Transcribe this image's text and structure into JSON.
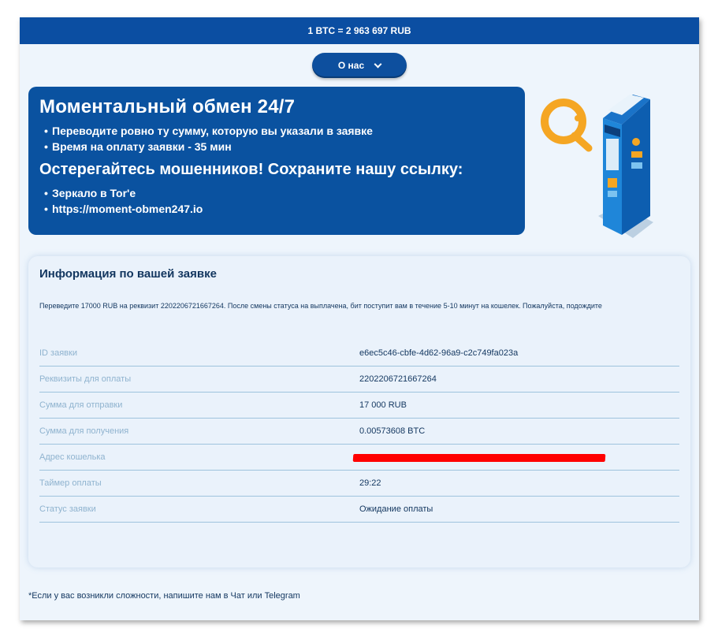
{
  "header": {
    "rate": "1 BTC = 2 963 697 RUB"
  },
  "nav": {
    "about_label": "О нас"
  },
  "banner": {
    "title": "Моментальный обмен 24/7",
    "bullets": [
      "Переводите ровно ту сумму, которую вы указали в заявке",
      "Время на оплату заявки - 35 мин"
    ],
    "warning_title": "Остерегайтесь мошенников! Сохраните нашу ссылку:",
    "links": [
      "Зеркало в Tor'e",
      "https://moment-obmen247.io"
    ]
  },
  "order": {
    "title": "Информация по вашей заявке",
    "note": "Переведите 17000 RUB на реквизит 2202206721667264. После смены статуса на выплачена, бит поступит вам в течение 5-10 минут на кошелек. Пожалуйста, подождите",
    "rows": [
      {
        "label": "ID заявки",
        "value": "e6ec5c46-cbfe-4d62-96a9-c2c749fa023a"
      },
      {
        "label": "Реквизиты для оплаты",
        "value": "2202206721667264"
      },
      {
        "label": "Сумма для отправки",
        "value": "17 000 RUB"
      },
      {
        "label": "Сумма для получения",
        "value": "0.00573608 BTC"
      },
      {
        "label": "Адрес кошелька",
        "value": ""
      },
      {
        "label": "Таймер оплаты",
        "value": "29:22"
      },
      {
        "label": "Статус заявки",
        "value": "Ожидание оплаты"
      }
    ]
  },
  "footer": {
    "text": "*Если у вас возникли сложности, напишите нам в Чат или Telegram"
  },
  "colors": {
    "primary": "#0b4ea2",
    "banner": "#0a52a0",
    "accent": "#f5a623",
    "redaction": "#ff0000"
  },
  "icons": {
    "qiwi_logo": "qiwi-logo-icon",
    "terminal": "payment-terminal-illustration"
  }
}
